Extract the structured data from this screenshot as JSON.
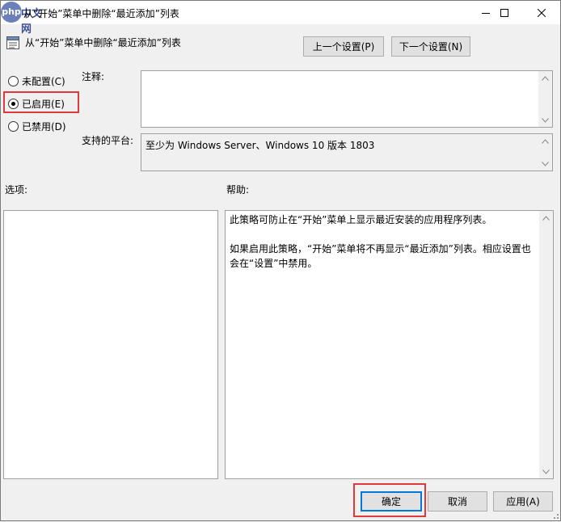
{
  "window": {
    "title": "从“开始”菜单中删除“最近添加”列表",
    "watermark_logo": "php",
    "watermark_text": "中文网"
  },
  "header": {
    "title": "从“开始”菜单中删除“最近添加”列表",
    "prev_setting_label": "上一个设置(P)",
    "next_setting_label": "下一个设置(N)"
  },
  "state": {
    "options": [
      {
        "label": "未配置(C)",
        "checked": false
      },
      {
        "label": "已启用(E)",
        "checked": true
      },
      {
        "label": "已禁用(D)",
        "checked": false
      }
    ]
  },
  "comment": {
    "label": "注释:",
    "value": ""
  },
  "platform": {
    "label": "支持的平台:",
    "value": "至少为 Windows Server、Windows 10 版本 1803"
  },
  "options_panel": {
    "label": "选项:"
  },
  "help_panel": {
    "label": "帮助:",
    "paragraphs": [
      "此策略可防止在“开始”菜单上显示最近安装的应用程序列表。",
      "如果启用此策略，“开始”菜单将不再显示“最近添加”列表。相应设置也会在“设置”中禁用。"
    ]
  },
  "footer": {
    "ok_label": "确定",
    "cancel_label": "取消",
    "apply_label": "应用(A)"
  },
  "colors": {
    "highlight": "#e0393a",
    "accent": "#0078d7"
  }
}
